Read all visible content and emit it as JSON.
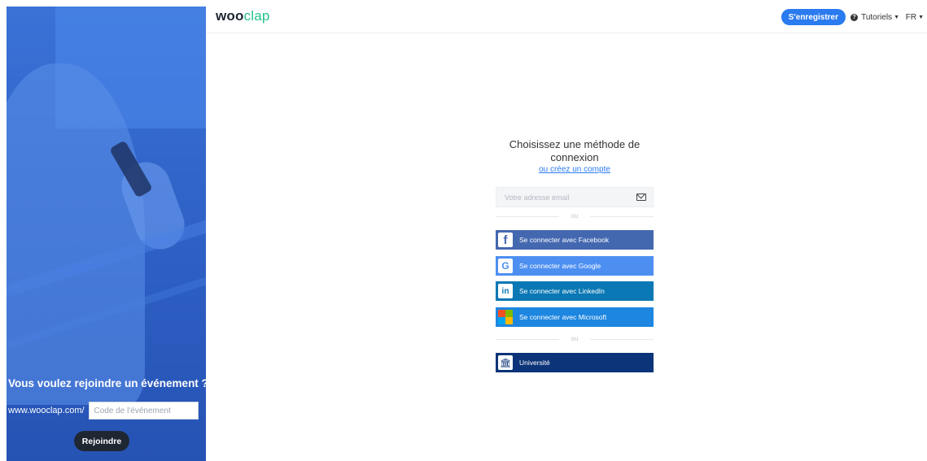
{
  "left_panel": {
    "join_title": "Vous voulez rejoindre un événement ?",
    "url_prefix": "www.wooclap.com/",
    "code_placeholder": "Code de l'événement",
    "join_button": "Rejoindre"
  },
  "header": {
    "logo_part1": "woo",
    "logo_part2": "clap",
    "signup_button": "S'enregistrer",
    "tutorials": "Tutoriels",
    "language": "FR"
  },
  "login": {
    "heading": "Choisissez une méthode de connexion",
    "create_account_link": "ou créez un compte",
    "email_placeholder": "Votre adresse email",
    "separator_1": "ou",
    "separator_2": "ou",
    "buttons": [
      {
        "label": "Se connecter avec Facebook",
        "icon": "facebook-icon",
        "color": "#4468b0"
      },
      {
        "label": "Se connecter avec Google",
        "icon": "google-icon",
        "color": "#4d8ff1"
      },
      {
        "label": "Se connecter avec LinkedIn",
        "icon": "linkedin-icon",
        "color": "#0a78b5"
      },
      {
        "label": "Se connecter avec Microsoft",
        "icon": "microsoft-icon",
        "color": "#1d86e0"
      }
    ],
    "university_button": {
      "label": "Université",
      "icon": "university-icon",
      "color": "#0c3478"
    }
  },
  "colors": {
    "brand_green": "#22c18b",
    "accent_blue": "#2a7af0",
    "dark": "#1f2733"
  }
}
